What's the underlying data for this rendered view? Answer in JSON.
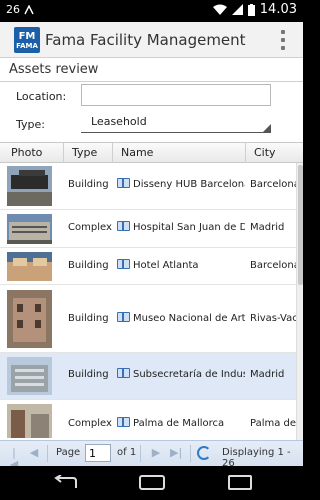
{
  "status_bar": {
    "left_text": "26",
    "time": "14.03"
  },
  "app": {
    "title": "Fama Facility Management",
    "logo_text_top": "FM",
    "logo_text_bottom": "FAMA"
  },
  "form": {
    "section_title": "Assets review",
    "location_label": "Location:",
    "location_value": "",
    "type_label": "Type:",
    "type_value": "Leasehold"
  },
  "table": {
    "columns": [
      "Photo",
      "Type",
      "Name",
      "City"
    ],
    "rows": [
      {
        "type": "Building",
        "name": "Disseny HUB Barcelona",
        "city": "Barcelona",
        "selected": false
      },
      {
        "type": "Complex",
        "name": "Hospital San Juan de Dios",
        "city": "Madrid",
        "selected": false
      },
      {
        "type": "Building",
        "name": "Hotel Atlanta",
        "city": "Barcelona",
        "selected": false
      },
      {
        "type": "Building",
        "name": "Museo Nacional de Arte C",
        "city": "Rivas-Vaci",
        "selected": false
      },
      {
        "type": "Building",
        "name": "Subsecretaría de Industri",
        "city": "Madrid",
        "selected": true
      },
      {
        "type": "Complex",
        "name": "Palma de Mallorca",
        "city": "Palma de M",
        "selected": false
      }
    ]
  },
  "pager": {
    "page_label": "Page",
    "page_value": "1",
    "of_label": "of 1",
    "display_text": "Displaying 1 - 26"
  },
  "colors": {
    "accent": "#1a5fa8",
    "selected_row": "#dfe8f6",
    "pager_bg": "#dbe5f1"
  }
}
